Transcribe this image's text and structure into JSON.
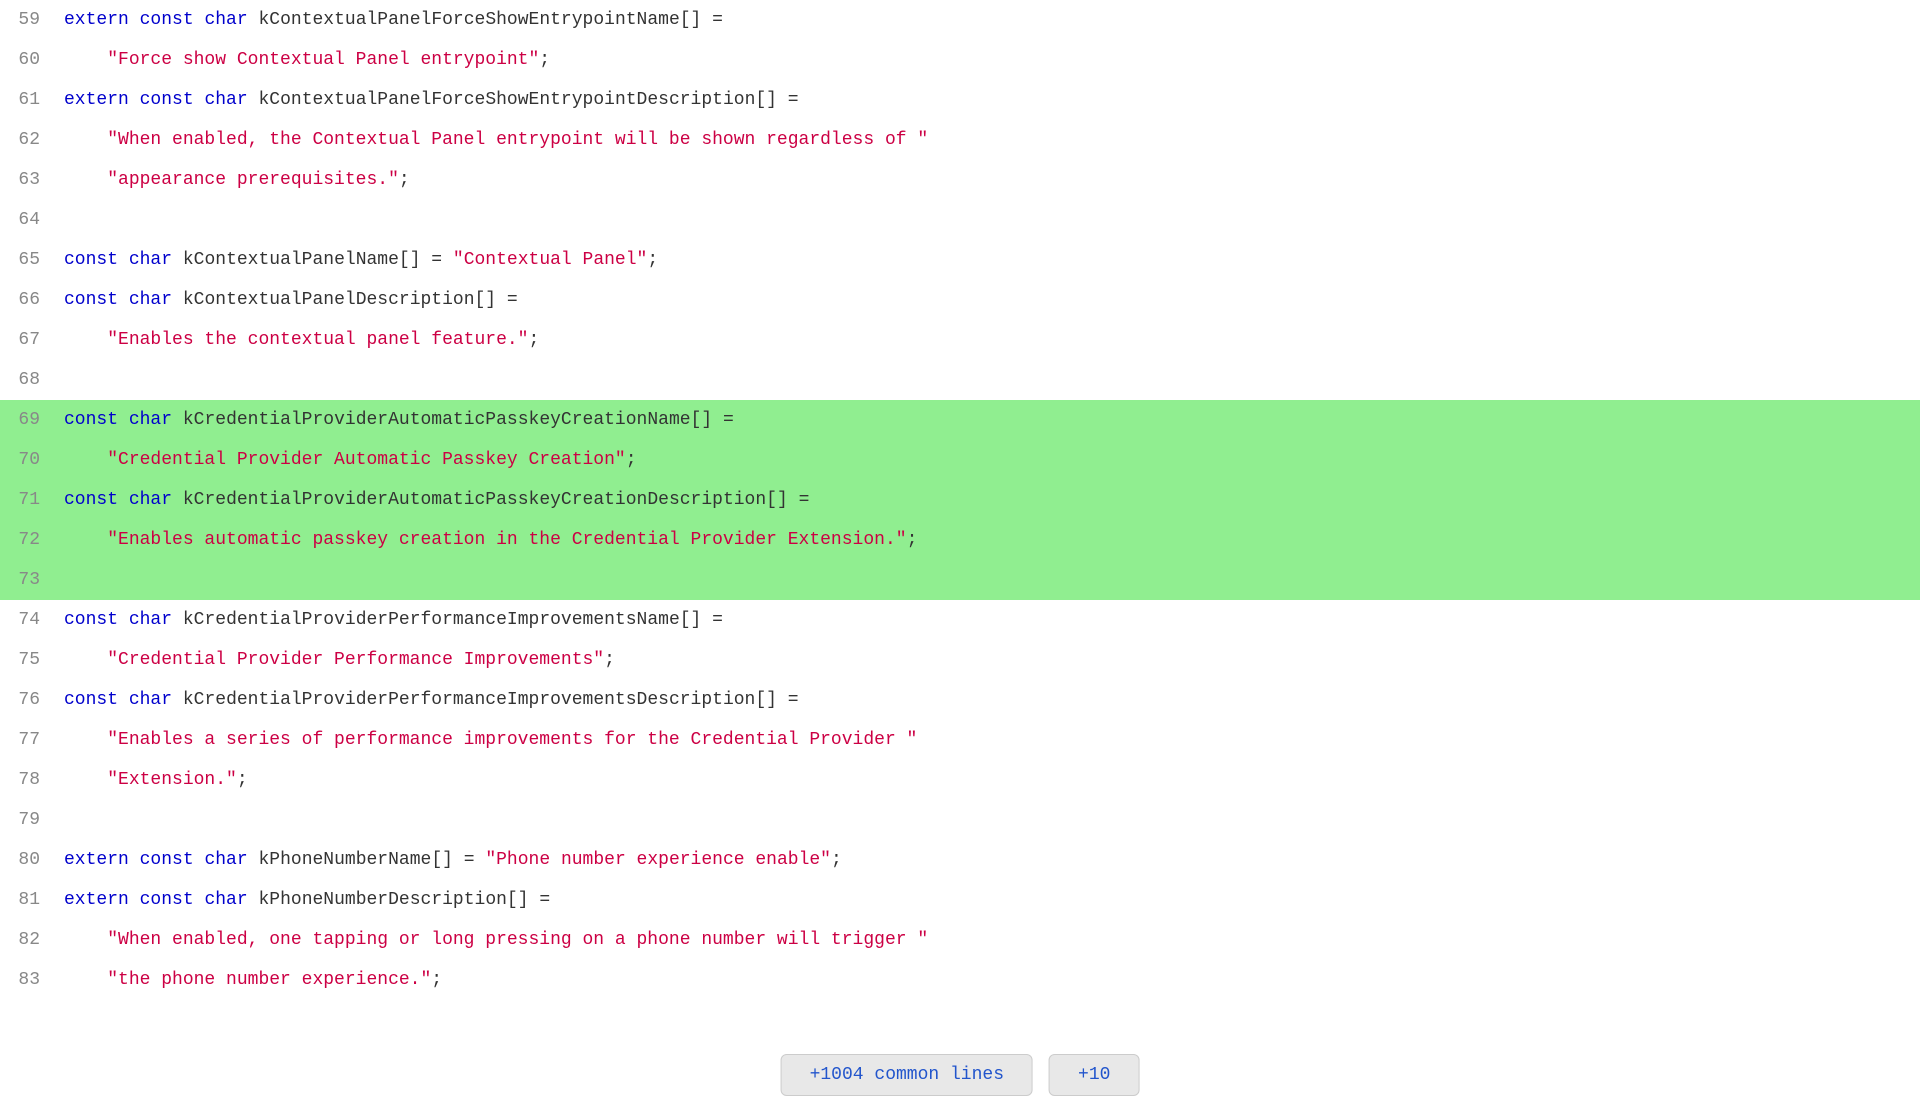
{
  "lines": [
    {
      "number": "59",
      "highlighted": false,
      "parts": [
        {
          "type": "kw",
          "text": "extern"
        },
        {
          "type": "op",
          "text": " "
        },
        {
          "type": "kw",
          "text": "const"
        },
        {
          "type": "op",
          "text": " "
        },
        {
          "type": "kw",
          "text": "char"
        },
        {
          "type": "op",
          "text": " "
        },
        {
          "type": "id",
          "text": "kContextualPanelForceShowEntrypointName[]"
        },
        {
          "type": "op",
          "text": " ="
        }
      ]
    },
    {
      "number": "60",
      "highlighted": false,
      "parts": [
        {
          "type": "indent",
          "text": "    "
        },
        {
          "type": "str",
          "text": "\"Force show Contextual Panel entrypoint\""
        },
        {
          "type": "op",
          "text": ";"
        }
      ]
    },
    {
      "number": "61",
      "highlighted": false,
      "parts": [
        {
          "type": "kw",
          "text": "extern"
        },
        {
          "type": "op",
          "text": " "
        },
        {
          "type": "kw",
          "text": "const"
        },
        {
          "type": "op",
          "text": " "
        },
        {
          "type": "kw",
          "text": "char"
        },
        {
          "type": "op",
          "text": " "
        },
        {
          "type": "id",
          "text": "kContextualPanelForceShowEntrypointDescription[]"
        },
        {
          "type": "op",
          "text": " ="
        }
      ]
    },
    {
      "number": "62",
      "highlighted": false,
      "parts": [
        {
          "type": "indent",
          "text": "    "
        },
        {
          "type": "str",
          "text": "\"When enabled, the Contextual Panel entrypoint will be shown regardless of \""
        }
      ]
    },
    {
      "number": "63",
      "highlighted": false,
      "parts": [
        {
          "type": "indent",
          "text": "    "
        },
        {
          "type": "str",
          "text": "\"appearance prerequisites.\""
        },
        {
          "type": "op",
          "text": ";"
        }
      ]
    },
    {
      "number": "64",
      "highlighted": false,
      "parts": []
    },
    {
      "number": "65",
      "highlighted": false,
      "parts": [
        {
          "type": "kw",
          "text": "const"
        },
        {
          "type": "op",
          "text": " "
        },
        {
          "type": "kw",
          "text": "char"
        },
        {
          "type": "op",
          "text": " "
        },
        {
          "type": "id",
          "text": "kContextualPanelName[]"
        },
        {
          "type": "op",
          "text": " = "
        },
        {
          "type": "str",
          "text": "\"Contextual Panel\""
        },
        {
          "type": "op",
          "text": ";"
        }
      ]
    },
    {
      "number": "66",
      "highlighted": false,
      "parts": [
        {
          "type": "kw",
          "text": "const"
        },
        {
          "type": "op",
          "text": " "
        },
        {
          "type": "kw",
          "text": "char"
        },
        {
          "type": "op",
          "text": " "
        },
        {
          "type": "id",
          "text": "kContextualPanelDescription[]"
        },
        {
          "type": "op",
          "text": " ="
        }
      ]
    },
    {
      "number": "67",
      "highlighted": false,
      "parts": [
        {
          "type": "indent",
          "text": "    "
        },
        {
          "type": "str",
          "text": "\"Enables the contextual panel feature.\""
        },
        {
          "type": "op",
          "text": ";"
        }
      ]
    },
    {
      "number": "68",
      "highlighted": false,
      "parts": []
    },
    {
      "number": "69",
      "highlighted": true,
      "parts": [
        {
          "type": "kw",
          "text": "const"
        },
        {
          "type": "op",
          "text": " "
        },
        {
          "type": "kw",
          "text": "char"
        },
        {
          "type": "op",
          "text": " "
        },
        {
          "type": "id",
          "text": "kCredentialProviderAutomaticPasskeyCreationName[]"
        },
        {
          "type": "op",
          "text": " ="
        }
      ]
    },
    {
      "number": "70",
      "highlighted": true,
      "parts": [
        {
          "type": "indent",
          "text": "    "
        },
        {
          "type": "str",
          "text": "\"Credential Provider Automatic Passkey Creation\""
        },
        {
          "type": "op",
          "text": ";"
        }
      ]
    },
    {
      "number": "71",
      "highlighted": true,
      "parts": [
        {
          "type": "kw",
          "text": "const"
        },
        {
          "type": "op",
          "text": " "
        },
        {
          "type": "kw",
          "text": "char"
        },
        {
          "type": "op",
          "text": " "
        },
        {
          "type": "id",
          "text": "kCredentialProviderAutomaticPasskeyCreationDescription[]"
        },
        {
          "type": "op",
          "text": " ="
        }
      ]
    },
    {
      "number": "72",
      "highlighted": true,
      "parts": [
        {
          "type": "indent",
          "text": "    "
        },
        {
          "type": "str",
          "text": "\"Enables automatic passkey creation in the Credential Provider Extension.\""
        },
        {
          "type": "op",
          "text": ";"
        }
      ]
    },
    {
      "number": "73",
      "highlighted": true,
      "parts": []
    },
    {
      "number": "74",
      "highlighted": false,
      "parts": [
        {
          "type": "kw",
          "text": "const"
        },
        {
          "type": "op",
          "text": " "
        },
        {
          "type": "kw",
          "text": "char"
        },
        {
          "type": "op",
          "text": " "
        },
        {
          "type": "id",
          "text": "kCredentialProviderPerformanceImprovementsName[]"
        },
        {
          "type": "op",
          "text": " ="
        }
      ]
    },
    {
      "number": "75",
      "highlighted": false,
      "parts": [
        {
          "type": "indent",
          "text": "    "
        },
        {
          "type": "str",
          "text": "\"Credential Provider Performance Improvements\""
        },
        {
          "type": "op",
          "text": ";"
        }
      ]
    },
    {
      "number": "76",
      "highlighted": false,
      "parts": [
        {
          "type": "kw",
          "text": "const"
        },
        {
          "type": "op",
          "text": " "
        },
        {
          "type": "kw",
          "text": "char"
        },
        {
          "type": "op",
          "text": " "
        },
        {
          "type": "id",
          "text": "kCredentialProviderPerformanceImprovementsDescription[]"
        },
        {
          "type": "op",
          "text": " ="
        }
      ]
    },
    {
      "number": "77",
      "highlighted": false,
      "parts": [
        {
          "type": "indent",
          "text": "    "
        },
        {
          "type": "str",
          "text": "\"Enables a series of performance improvements for the Credential Provider \""
        }
      ]
    },
    {
      "number": "78",
      "highlighted": false,
      "parts": [
        {
          "type": "indent",
          "text": "    "
        },
        {
          "type": "str",
          "text": "\"Extension.\""
        },
        {
          "type": "op",
          "text": ";"
        }
      ]
    },
    {
      "number": "79",
      "highlighted": false,
      "parts": []
    },
    {
      "number": "80",
      "highlighted": false,
      "parts": [
        {
          "type": "kw",
          "text": "extern"
        },
        {
          "type": "op",
          "text": " "
        },
        {
          "type": "kw",
          "text": "const"
        },
        {
          "type": "op",
          "text": " "
        },
        {
          "type": "kw",
          "text": "char"
        },
        {
          "type": "op",
          "text": " "
        },
        {
          "type": "id",
          "text": "kPhoneNumberName[]"
        },
        {
          "type": "op",
          "text": " = "
        },
        {
          "type": "str",
          "text": "\"Phone number experience enable\""
        },
        {
          "type": "op",
          "text": ";"
        }
      ]
    },
    {
      "number": "81",
      "highlighted": false,
      "parts": [
        {
          "type": "kw",
          "text": "extern"
        },
        {
          "type": "op",
          "text": " "
        },
        {
          "type": "kw",
          "text": "const"
        },
        {
          "type": "op",
          "text": " "
        },
        {
          "type": "kw",
          "text": "char"
        },
        {
          "type": "op",
          "text": " "
        },
        {
          "type": "id",
          "text": "kPhoneNumberDescription[]"
        },
        {
          "type": "op",
          "text": " ="
        }
      ]
    },
    {
      "number": "82",
      "highlighted": false,
      "parts": [
        {
          "type": "indent",
          "text": "    "
        },
        {
          "type": "str",
          "text": "\"When enabled, one tapping or long pressing on a phone number will trigger \""
        }
      ]
    },
    {
      "number": "83",
      "highlighted": false,
      "parts": [
        {
          "type": "indent",
          "text": "    "
        },
        {
          "type": "str",
          "text": "\"the phone number experience.\""
        },
        {
          "type": "op",
          "text": ";"
        }
      ]
    }
  ],
  "buttons": [
    {
      "label": "+1004 common lines",
      "id": "btn-common"
    },
    {
      "label": "+10",
      "id": "btn-ten"
    }
  ]
}
